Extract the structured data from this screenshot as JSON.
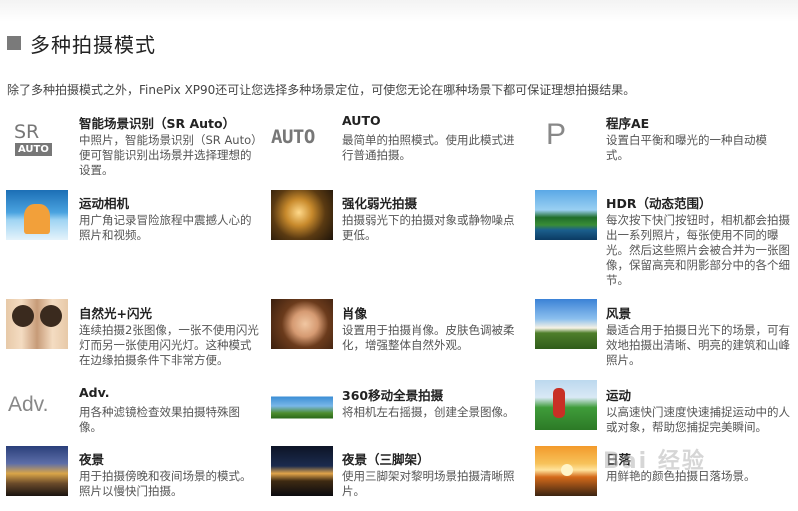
{
  "header": {
    "title": "多种拍摄模式"
  },
  "intro": "除了多种拍摄模式之外，FinePix XP90还可让您选择多种场景定位，可使您无论在哪种场景下都可保证理想拍摄结果。",
  "icons": {
    "sr_text": "SR",
    "sr_badge": "AUTO",
    "auto_text": "AUTO",
    "p_text": "P",
    "adv_text": "Adv."
  },
  "modes": [
    {
      "name": "智能场景识别（SR Auto）",
      "desc": "中照片，智能场景识别（SR Auto）便可智能识别出场景并选择理想的设置。",
      "icon": "sr-auto-icon"
    },
    {
      "name": "AUTO",
      "desc": "最简单的拍照模式。使用此模式进行普通拍摄。",
      "icon": "auto-icon"
    },
    {
      "name": "程序AE",
      "desc": "设置白平衡和曝光的一种自动模式。",
      "icon": "p-icon"
    },
    {
      "name": "运动相机",
      "desc": "用广角记录冒险旅程中震撼人心的照片和视频。",
      "icon": "photo-action-camera"
    },
    {
      "name": "强化弱光拍摄",
      "desc": "拍摄弱光下的拍摄对象或静物噪点更低。",
      "icon": "photo-low-light"
    },
    {
      "name": "HDR（动态范围）",
      "desc": "每次按下快门按钮时，相机都会拍摄出一系列照片，每张使用不同的曝光。然后这些照片会被合并为一张图像，保留高亮和阴影部分中的各个细节。",
      "icon": "photo-hdr"
    },
    {
      "name": "自然光+闪光",
      "desc": "连续拍摄2张图像，一张不使用闪光灯而另一张使用闪光灯。这种模式在边缘拍摄条件下非常方便。",
      "icon": "photo-natural-flash"
    },
    {
      "name": "肖像",
      "desc": "设置用于拍摄肖像。皮肤色调被柔化，增强整体自然外观。",
      "icon": "photo-portrait"
    },
    {
      "name": "风景",
      "desc": "最适合用于拍摄日光下的场景，可有效地拍摄出清晰、明亮的建筑和山峰照片。",
      "icon": "photo-landscape"
    },
    {
      "name": "Adv.",
      "desc": "用各种滤镜检查效果拍摄特殊图像。",
      "icon": "adv-icon"
    },
    {
      "name": "360移动全景拍摄",
      "desc": "将相机左右摇摄，创建全景图像。",
      "icon": "photo-panorama"
    },
    {
      "name": "运动",
      "desc": "以高速快门速度快速捕捉运动中的人或对象，帮助您捕捉完美瞬间。",
      "icon": "photo-sports"
    },
    {
      "name": "夜景",
      "desc": "用于拍摄傍晚和夜间场景的模式。照片以慢快门拍摄。",
      "icon": "photo-night"
    },
    {
      "name": "夜景（三脚架）",
      "desc": "使用三脚架对黎明场景拍摄清晰照片。",
      "icon": "photo-night-tripod"
    },
    {
      "name": "日落",
      "desc": "用鲜艳的颜色拍摄日落场景。",
      "icon": "photo-sunset"
    }
  ],
  "watermark": "Bai 经验"
}
